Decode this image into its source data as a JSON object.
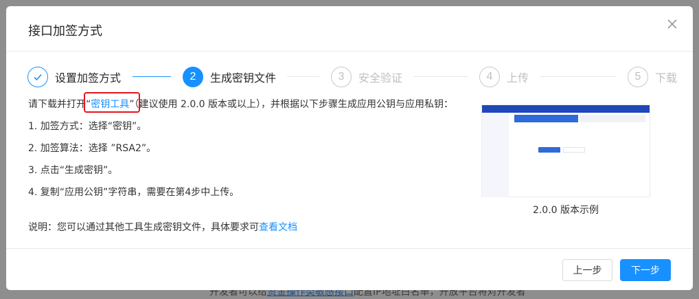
{
  "background": {
    "text_prefix": "开发者可以给",
    "text_link": "资金操作类敏感接口",
    "text_suffix": "配置IP地址白名单，开放平台将对开发者"
  },
  "modal": {
    "title": "接口加签方式",
    "close_label": "X"
  },
  "steps": [
    {
      "number": "1",
      "label": "设置加签方式",
      "status": "done"
    },
    {
      "number": "2",
      "label": "生成密钥文件",
      "status": "active"
    },
    {
      "number": "3",
      "label": "安全验证",
      "status": "wait"
    },
    {
      "number": "4",
      "label": "上传",
      "status": "wait"
    },
    {
      "number": "5",
      "label": "下载",
      "status": "wait"
    }
  ],
  "content": {
    "intro_prefix": "请下载并打开“",
    "intro_link": "密钥工具",
    "intro_suffix": "”（建议使用 2.0.0 版本或以上），并根据以下步骤生成应用公钥与应用私钥：",
    "step1": "1. 加签方式：选择“密钥”。",
    "step2": "2. 加签算法：选择 ”RSA2”。",
    "step3": "3. 点击“生成密钥”。",
    "step4": "4. 复制“应用公钥”字符串，需要在第4步中上传。",
    "note_prefix": "说明：您可以通过其他工具生成密钥文件，具体要求可",
    "note_link": "查看文档"
  },
  "preview": {
    "caption": "2.0.0 版本示例"
  },
  "footer": {
    "prev_label": "上一步",
    "next_label": "下一步"
  },
  "colors": {
    "primary": "#1890ff",
    "highlight_box": "#e5131b"
  }
}
